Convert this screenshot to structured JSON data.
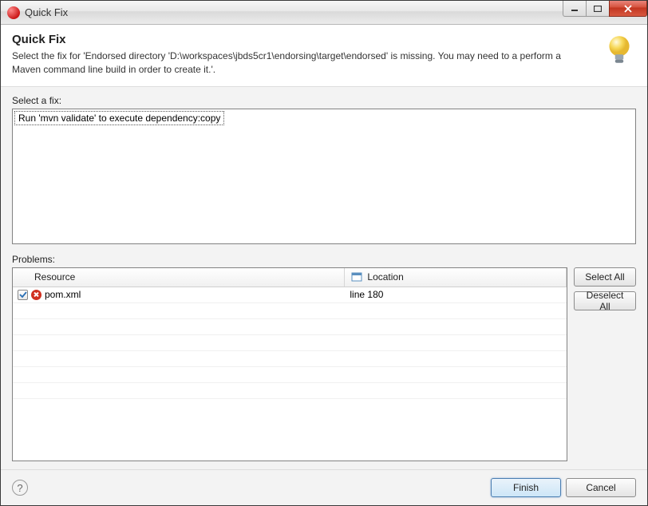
{
  "titlebar": {
    "title": "Quick Fix"
  },
  "header": {
    "title": "Quick Fix",
    "description": "Select the fix for 'Endorsed directory 'D:\\workspaces\\jbds5cr1\\endorsing\\target\\endorsed' is missing. You may need to a perform a Maven command line build in order to create it.'."
  },
  "labels": {
    "select_fix": "Select a fix:",
    "problems": "Problems:"
  },
  "fixes": [
    {
      "text": "Run 'mvn validate' to execute dependency:copy",
      "selected": true
    }
  ],
  "columns": {
    "resource": "Resource",
    "location": "Location"
  },
  "problems": [
    {
      "checked": true,
      "resource": "pom.xml",
      "location": "line 180"
    }
  ],
  "buttons": {
    "select_all": "Select All",
    "deselect_all": "Deselect All",
    "finish": "Finish",
    "cancel": "Cancel"
  }
}
